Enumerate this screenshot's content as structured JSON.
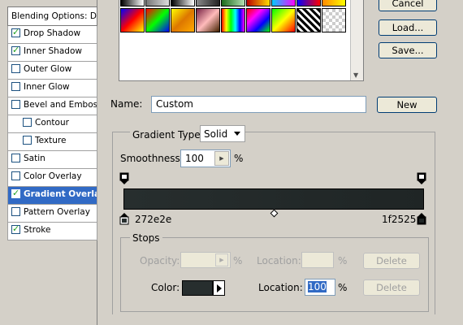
{
  "left_panel": {
    "header": "Blending Options: Default",
    "items": [
      {
        "label": "Drop Shadow",
        "checked": true
      },
      {
        "label": "Inner Shadow",
        "checked": true
      },
      {
        "label": "Outer Glow",
        "checked": false
      },
      {
        "label": "Inner Glow",
        "checked": false
      },
      {
        "label": "Bevel and Emboss",
        "checked": false
      },
      {
        "label": "Contour",
        "checked": false,
        "sub": true
      },
      {
        "label": "Texture",
        "checked": false,
        "sub": true
      },
      {
        "label": "Satin",
        "checked": false
      },
      {
        "label": "Color Overlay",
        "checked": false
      },
      {
        "label": "Gradient Overlay",
        "checked": true,
        "selected": true
      },
      {
        "label": "Pattern Overlay",
        "checked": false
      },
      {
        "label": "Stroke",
        "checked": true
      }
    ]
  },
  "buttons": {
    "cancel": "Cancel",
    "load": "Load...",
    "save": "Save...",
    "new": "New"
  },
  "name": {
    "label": "Name:",
    "value": "Custom"
  },
  "gradient_type": {
    "label": "Gradient Type:",
    "value": "Solid"
  },
  "smoothness": {
    "label": "Smoothness:",
    "value": "100",
    "unit": "%"
  },
  "gradient": {
    "left_color": "#272e2e",
    "right_color": "#1f2525",
    "left_label": "272e2e",
    "right_label": "1f2525"
  },
  "stops": {
    "title": "Stops",
    "opacity_label": "Opacity:",
    "opacity_unit": "%",
    "opacity_location_label": "Location:",
    "opacity_location_unit": "%",
    "delete": "Delete",
    "color_label": "Color:",
    "color_location_label": "Location:",
    "color_location_value": "100",
    "color_location_unit": "%"
  }
}
